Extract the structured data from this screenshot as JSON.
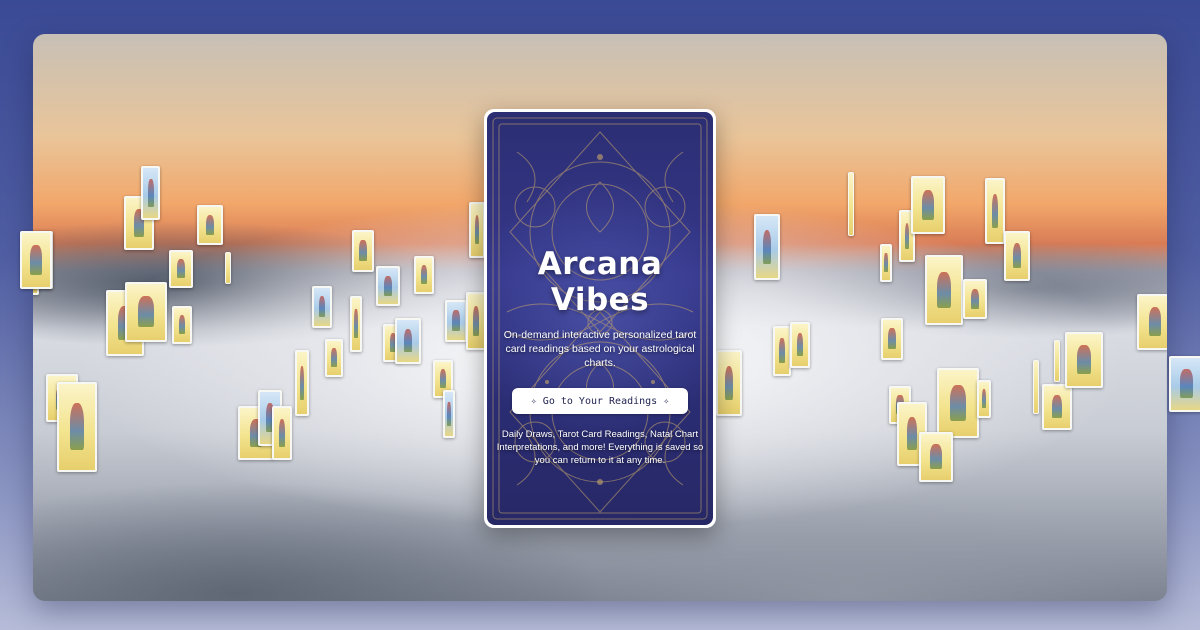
{
  "hero": {
    "title": "Arcana Vibes",
    "subtitle": "On-demand interactive personalized tarot card readings based on your astrological charts.",
    "cta_label": "Go to Your Readings",
    "cta_icon_left": "✧",
    "cta_icon_right": "✧",
    "description": "Daily Draws, Tarot Card Readings, Natal Chart Interpretations, and more! Everything is saved so you can return to it at any time."
  },
  "colors": {
    "page_background": "#3b4a95",
    "card_back": "#2c2e73",
    "card_ornament": "#c9a86a",
    "button_background": "#ffffff",
    "button_text": "#1e2150"
  },
  "background": {
    "scene": "sky-above-clouds-sunset",
    "decoration": "floating-tarot-cards"
  }
}
